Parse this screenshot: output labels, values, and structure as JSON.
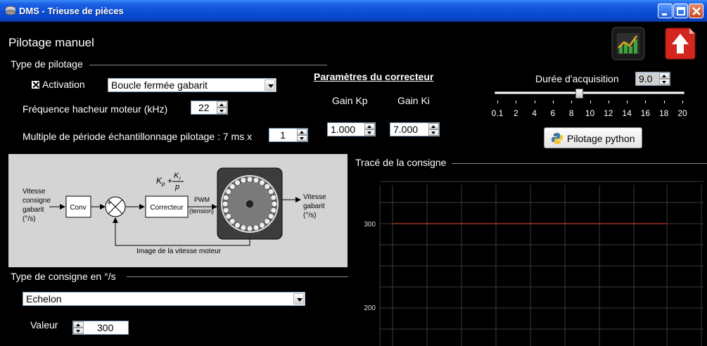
{
  "window": {
    "title": "DMS - Trieuse de pièces"
  },
  "page": {
    "title": "Pilotage manuel"
  },
  "toolbar": {
    "chart_icon": "chart-icon",
    "quit_icon": "up-arrow-icon"
  },
  "pilotage": {
    "group_label": "Type de pilotage",
    "activation_label": "Activation",
    "activation_checked": true,
    "mode_selected": "Boucle fermée gabarit",
    "freq_label": "Fréquence hacheur moteur (kHz)",
    "freq_value": "22",
    "multiple_label": "Multiple de période échantillonnage pilotage : 7 ms x",
    "multiple_value": "1"
  },
  "correcteur": {
    "title": "Paramètres du correcteur",
    "kp_label": "Gain Kp",
    "ki_label": "Gain Ki",
    "kp_value": "1.000",
    "ki_value": "7.000"
  },
  "acquisition": {
    "label": "Durée d'acquisition",
    "value": "9.0",
    "slider_ticks": [
      "0.1",
      "2",
      "4",
      "6",
      "8",
      "10",
      "12",
      "14",
      "16",
      "18",
      "20"
    ],
    "python_button": "Pilotage python"
  },
  "diagram": {
    "input_label": "Vitesse\nconsigne\ngabarit\n(°/s)",
    "conv": "Conv",
    "correcteur": "Correcteur",
    "pwm": "PWM\n(tension)",
    "output_label": "Vitesse\ngabarit\n(°/s)",
    "feedback": "Image de la vitesse moteur",
    "formula_kp": "K",
    "formula_sub_p": "p",
    "formula_ki": "K",
    "formula_sub_i": "i",
    "formula_den": "p",
    "plus": "+",
    "minus": "-"
  },
  "consigne": {
    "group_label": "Type de consigne en °/s",
    "type_selected": "Echelon",
    "valeur_label": "Valeur",
    "valeur_value": "300"
  },
  "trace": {
    "group_label": "Tracé de la consigne",
    "y_tick_300": "300",
    "y_tick_200": "200"
  },
  "chart_data": {
    "type": "line",
    "title": "",
    "xlabel": "",
    "ylabel": "",
    "ylim_visible": [
      150,
      330
    ],
    "y_ticks": [
      200,
      300
    ],
    "series": [
      {
        "values": [
          300,
          300
        ],
        "x": [
          0,
          9
        ],
        "color": "#c0392b"
      }
    ],
    "grid": true,
    "grid_color": "#3a3a3a"
  },
  "colors": {
    "titlebar": "#0a4fd8",
    "background": "#000000",
    "series": "#c0392b"
  }
}
